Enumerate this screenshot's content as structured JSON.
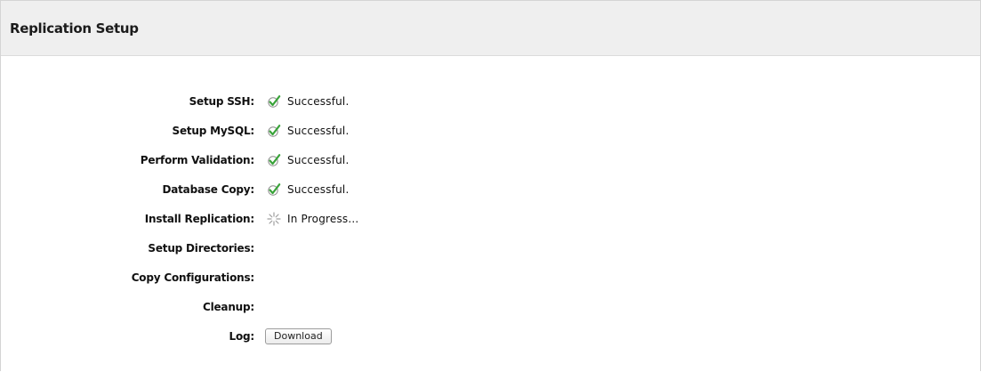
{
  "panel": {
    "title": "Replication Setup"
  },
  "steps": [
    {
      "label": "Setup SSH:",
      "status": "Successful.",
      "icon": "check-icon"
    },
    {
      "label": "Setup MySQL:",
      "status": "Successful.",
      "icon": "check-icon"
    },
    {
      "label": "Perform Validation:",
      "status": "Successful.",
      "icon": "check-icon"
    },
    {
      "label": "Database Copy:",
      "status": "Successful.",
      "icon": "check-icon"
    },
    {
      "label": "Install Replication:",
      "status": "In Progress...",
      "icon": "spinner-icon"
    },
    {
      "label": "Setup Directories:",
      "status": "",
      "icon": ""
    },
    {
      "label": "Copy Configurations:",
      "status": "",
      "icon": ""
    },
    {
      "label": "Cleanup:",
      "status": "",
      "icon": ""
    }
  ],
  "log": {
    "label": "Log:",
    "button_label": "Download"
  },
  "colors": {
    "header_bg": "#efefef",
    "check_green": "#3aa33a",
    "spinner_gray": "#a0a0a0"
  }
}
